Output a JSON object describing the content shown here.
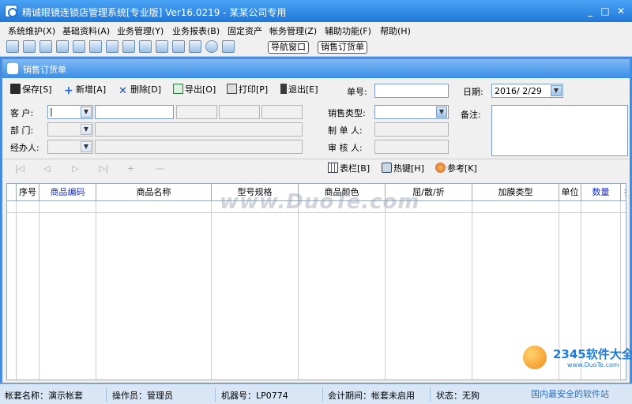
{
  "window": {
    "title": "精诚眼镜连锁店管理系统[专业版] Ver16.0219 - 某某公司专用",
    "controls": {
      "min": "_",
      "max": "□",
      "close": "✕"
    }
  },
  "menu": [
    "系统维护(X)",
    "基础资料(A)",
    "业务管理(Y)",
    "业务报表(B)",
    "固定资产",
    "帐务管理(Z)",
    "辅助功能(F)",
    "帮助(H)"
  ],
  "toolbar": {
    "icons": [
      "window-icon",
      "list-icon",
      "copy-icon",
      "tools-icon",
      "report-icon",
      "users-icon",
      "people-icon",
      "exchange-icon",
      "folder-icon",
      "card-icon",
      "save-disk-icon",
      "printer-icon",
      "help-icon",
      "exit-icon"
    ],
    "nav_button": "导航窗口",
    "order_button": "销售订货单"
  },
  "doc": {
    "title": "销售订货单",
    "actions": {
      "save": "保存[S]",
      "add": "新增[A]",
      "delete": "删除[D]",
      "export": "导出[O]",
      "print": "打印[P]",
      "exit": "退出[E]"
    },
    "order_no_label": "单号:",
    "order_no_value": "",
    "date_label": "日期:",
    "date_value": "2016/ 2/29",
    "customer_label": "客  户:",
    "dept_label": "部  门:",
    "handler_label": "经办人:",
    "sale_type_label": "销售类型:",
    "maker_label": "制 单 人:",
    "reviewer_label": "审 核 人:",
    "remark_label": "备注:",
    "customer_code": "|",
    "nav": [
      "|◁",
      "◁",
      "▷",
      "▷|",
      "+",
      "—"
    ],
    "tools": {
      "columns": "表栏[B]",
      "hotkeys": "热键[H]",
      "reference": "参考[K]"
    },
    "columns": [
      {
        "label": "序号",
        "blue": false
      },
      {
        "label": "商品编码",
        "blue": true
      },
      {
        "label": "商品名称",
        "blue": false
      },
      {
        "label": "型号规格",
        "blue": false
      },
      {
        "label": "商品颜色",
        "blue": false
      },
      {
        "label": "屈/散/折",
        "blue": false
      },
      {
        "label": "加膜类型",
        "blue": false
      },
      {
        "label": "单位",
        "blue": false
      },
      {
        "label": "数量",
        "blue": true
      },
      {
        "label": "折",
        "blue": true
      }
    ]
  },
  "status": {
    "account": "帐套名称：演示帐套",
    "operator": "操作员：管理员",
    "machine": "机器号：LP0774",
    "period": "会计期间：帐套未启用",
    "state": "状态：无狗"
  },
  "watermarks": {
    "duote": "www.DuoTe.com",
    "logo_big": "2345软件大全",
    "logo_small": "www.DuoTe.com",
    "safe": "国内最安全的软件站"
  },
  "colors": {
    "accent": "#3a8ee6",
    "column_blue": "#1a2fc7"
  }
}
